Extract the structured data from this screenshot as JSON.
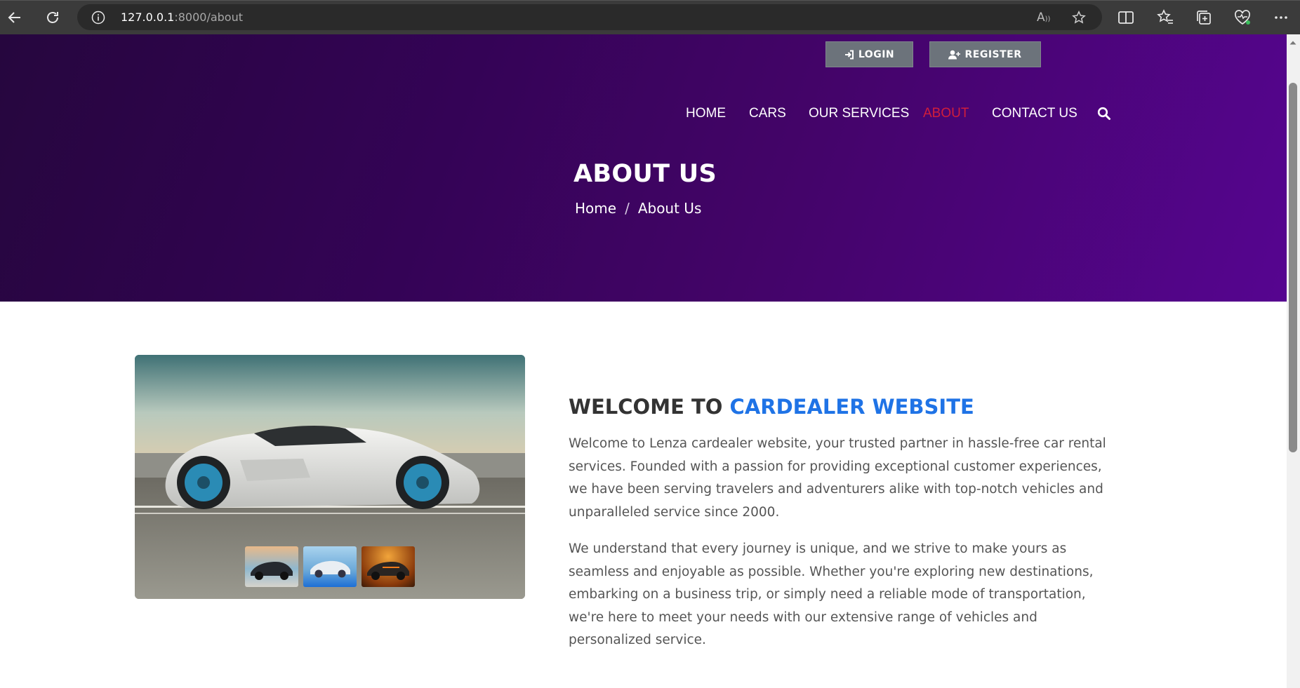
{
  "browser": {
    "url_host": "127.0.0.1",
    "url_path": ":8000/about",
    "read_aloud_label": "A"
  },
  "auth": {
    "login_label": "LOGIN",
    "register_label": "REGISTER"
  },
  "nav": {
    "items": [
      {
        "label": "HOME",
        "active": false
      },
      {
        "label": "CARS",
        "active": false
      },
      {
        "label": "OUR SERVICES",
        "active": false
      },
      {
        "label": "ABOUT",
        "active": true
      },
      {
        "label": "CONTACT US",
        "active": false
      }
    ]
  },
  "hero": {
    "title": "ABOUT US",
    "breadcrumb": {
      "home": "Home",
      "separator": "/",
      "current": "About Us"
    }
  },
  "welcome": {
    "title_prefix": "WELCOME TO",
    "title_highlight": "CARDEALER WEBSITE",
    "paragraph_1": "Welcome to Lenza cardealer website, your trusted partner in hassle-free car rental services. Founded with a passion for providing exceptional customer experiences, we have been serving travelers and adventurers alike with top-notch vehicles and unparalleled service since 2000.",
    "paragraph_2": "We understand that every journey is unique, and we strive to make yours as seamless and enjoyable as possible. Whether you're exploring new destinations, embarking on a business trip, or simply need a reliable mode of transportation, we're here to meet your needs with our extensive range of vehicles and personalized service."
  },
  "colors": {
    "accent_blue": "#1f73e6",
    "active_nav": "#d11d3b",
    "hero_dark": "#26063e",
    "hero_light": "#560590",
    "button_gray": "#6c737b"
  }
}
